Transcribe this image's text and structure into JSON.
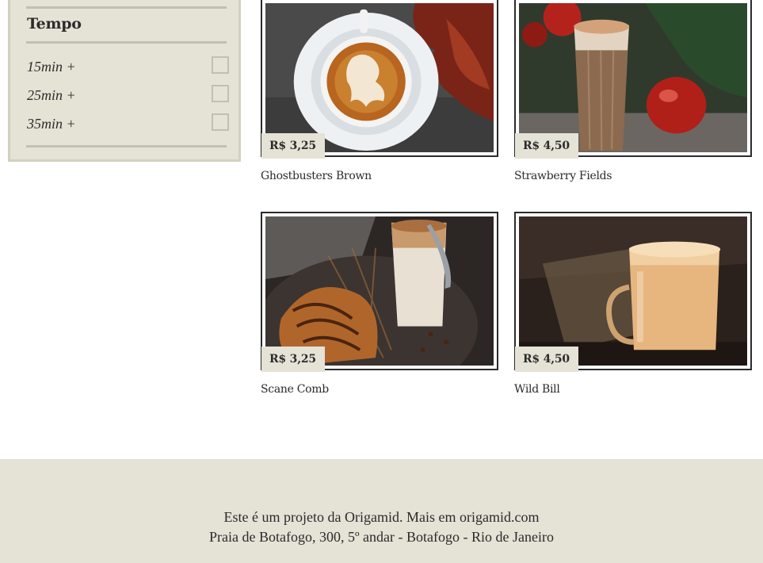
{
  "filter": {
    "title": "Tempo",
    "options": [
      "15min +",
      "25min +",
      "35min +"
    ]
  },
  "products": [
    {
      "name": "Ghostbusters Brown",
      "price": "R$ 3,25",
      "image": "latte-art-ghost-icon"
    },
    {
      "name": "Strawberry Fields",
      "price": "R$ 4,50",
      "image": "iced-latte-glass-icon"
    },
    {
      "name": "Scane Comb",
      "price": "R$ 3,25",
      "image": "croissant-coffee-icon"
    },
    {
      "name": "Wild Bill",
      "price": "R$ 4,50",
      "image": "glass-mug-coffee-icon"
    }
  ],
  "footer": {
    "text": "Este é um projeto da Origamid. Mais em ",
    "link": "origamid.com",
    "address": "Praia de Botafogo, 300, 5º andar - Botafogo - Rio de Janeiro"
  },
  "colors": {
    "panel": "#e5e2d6",
    "border": "#2b2b2b",
    "text": "#2b2b2b"
  }
}
